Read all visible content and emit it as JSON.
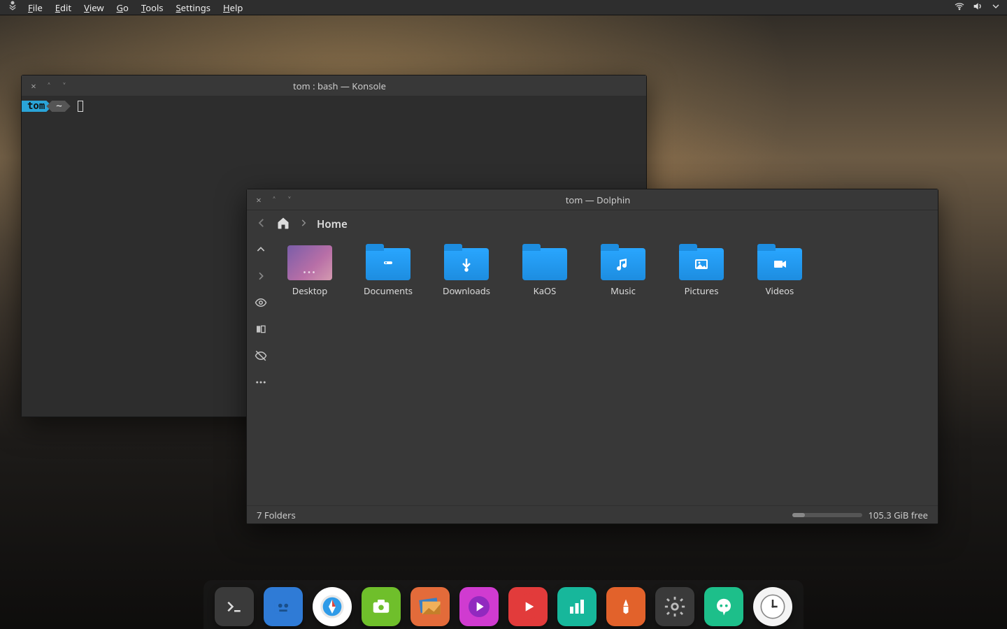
{
  "menubar": {
    "items": [
      "File",
      "Edit",
      "View",
      "Go",
      "Tools",
      "Settings",
      "Help"
    ]
  },
  "konsole": {
    "title": "tom : bash — Konsole",
    "prompt_user": "tom",
    "prompt_path": "~"
  },
  "dolphin": {
    "title": "tom — Dolphin",
    "breadcrumb": "Home",
    "folders": [
      {
        "name": "Desktop",
        "kind": "desktop"
      },
      {
        "name": "Documents",
        "kind": "docs"
      },
      {
        "name": "Downloads",
        "kind": "downloads"
      },
      {
        "name": "KaOS",
        "kind": "plain"
      },
      {
        "name": "Music",
        "kind": "music"
      },
      {
        "name": "Pictures",
        "kind": "pictures"
      },
      {
        "name": "Videos",
        "kind": "videos"
      }
    ],
    "status_left": "7 Folders",
    "status_right": "105.3 GiB free"
  },
  "dock": {
    "apps": [
      {
        "name": "terminal",
        "bg": "#3a3a3a"
      },
      {
        "name": "files",
        "bg": "#2f7bd6"
      },
      {
        "name": "browser",
        "bg": "#ffffff"
      },
      {
        "name": "screenshot",
        "bg": "#6fbf2b"
      },
      {
        "name": "photos",
        "bg": "#e36b3a"
      },
      {
        "name": "media",
        "bg": "#d03bd0"
      },
      {
        "name": "youtube",
        "bg": "#e23b3b"
      },
      {
        "name": "stats",
        "bg": "#17b79b"
      },
      {
        "name": "writer",
        "bg": "#e2622b"
      },
      {
        "name": "settings",
        "bg": "#3a3a3a"
      },
      {
        "name": "chat",
        "bg": "#1dbf8a"
      },
      {
        "name": "clock",
        "bg": "#f4f4f4"
      }
    ]
  }
}
